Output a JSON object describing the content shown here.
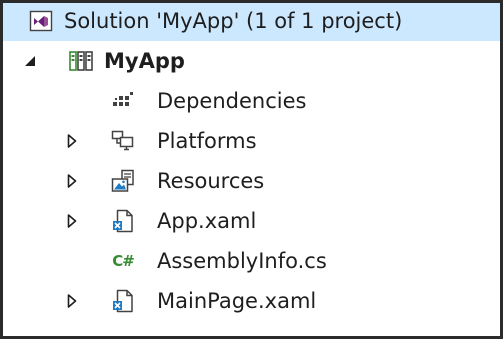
{
  "panel": "Solution Explorer",
  "tree": {
    "solution": {
      "label": "Solution 'MyApp' (1 of 1 project)",
      "icon": "visual-studio-solution-icon"
    },
    "project": {
      "label": "MyApp",
      "icon": "csharp-project-icon",
      "expanded": true
    },
    "items": [
      {
        "label": "Dependencies",
        "icon": "dependencies-icon",
        "expandable": false
      },
      {
        "label": "Platforms",
        "icon": "platforms-icon",
        "expandable": true
      },
      {
        "label": "Resources",
        "icon": "resources-folder-icon",
        "expandable": true
      },
      {
        "label": "App.xaml",
        "icon": "xaml-file-icon",
        "expandable": true
      },
      {
        "label": "AssemblyInfo.cs",
        "icon": "csharp-file-icon",
        "expandable": false
      },
      {
        "label": "MainPage.xaml",
        "icon": "xaml-file-icon",
        "expandable": true
      }
    ]
  },
  "colors": {
    "selection": "#cce8ff",
    "vs_purple": "#68217a",
    "csharp_green": "#388a34",
    "folder_blue": "#1e7bc6"
  }
}
